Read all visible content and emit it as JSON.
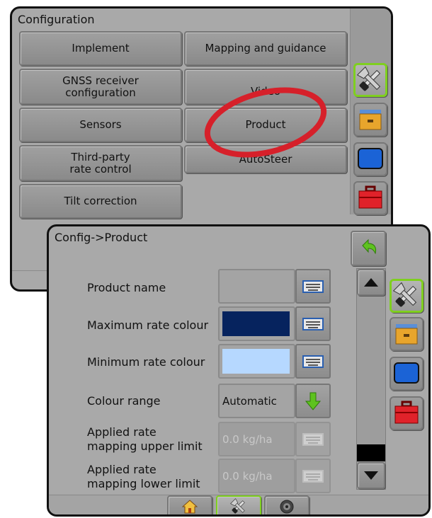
{
  "config_panel": {
    "title": "Configuration",
    "buttons": {
      "implement": "Implement",
      "mapping": "Mapping and guidance",
      "gnss": "GNSS receiver\nconfiguration",
      "video": "Video",
      "sensors": "Sensors",
      "product": "Product",
      "third_party": "Third-party\nrate control",
      "autosteer": "AutoSteer",
      "tilt": "Tilt correction"
    }
  },
  "product_panel": {
    "title": "Config->Product",
    "rows": [
      {
        "label": "Product name",
        "value": ""
      },
      {
        "label": "Maximum rate colour",
        "color": "#06235e"
      },
      {
        "label": "Minimum rate colour",
        "color": "#b6d8ff"
      },
      {
        "label": "Colour range",
        "value": "Automatic"
      },
      {
        "label": "Applied rate\nmapping upper limit",
        "value": "0.0 kg/ha"
      },
      {
        "label": "Applied rate\nmapping lower limit",
        "value": "0.0 kg/ha"
      }
    ]
  },
  "sidebar_icons": [
    "tools-icon",
    "drawer-icon",
    "monitor-icon",
    "toolbox-icon"
  ],
  "bottom_tabs": [
    "home-icon",
    "tools-icon",
    "camera-icon"
  ],
  "colors": {
    "highlight_ellipse": "#d6202a",
    "selected_border": "#7fcf1f"
  }
}
